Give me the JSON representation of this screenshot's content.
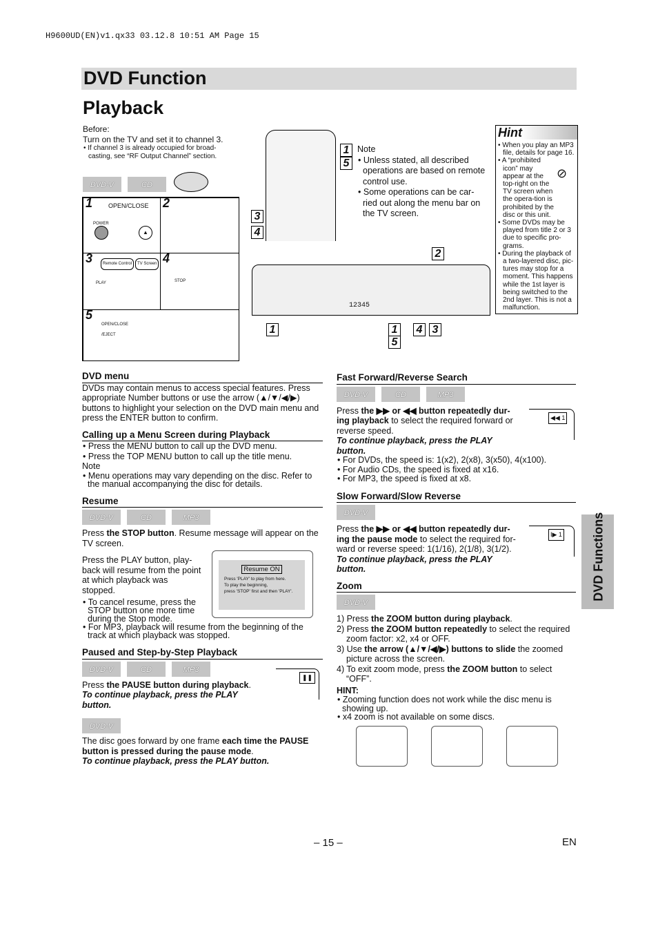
{
  "header": "H9600UD(EN)v1.qx33   03.12.8   10:51 AM   Page 15",
  "title": "DVD Function",
  "subtitle": "Playback",
  "side_tab": "DVD Functions",
  "before": {
    "label": "Before:",
    "text": "Turn on the TV and set it to channel 3.",
    "bullet": "If channel 3 is already occupied for broad-casting, see “RF Output Channel” section."
  },
  "badges": {
    "dvd": "DVD-V",
    "cd": "CD",
    "mp3": "MP3"
  },
  "steps": {
    "s1": "1",
    "s2": "2",
    "s3": "3",
    "s4": "4",
    "s5": "5",
    "open_close": "OPEN/CLOSE",
    "power": "POWER",
    "open_close_eject": "OPEN/CLOSE /EJECT",
    "remote_control": "Remote Control",
    "tv_screen": "TV Screen",
    "play": "PLAY",
    "stop": "STOP"
  },
  "note": {
    "label": "Note",
    "items": [
      "Unless stated, all described operations are based on remote control use.",
      "Some operations can be car-ried out along the menu bar on the TV screen."
    ]
  },
  "display_readout": "12345",
  "hint": {
    "title": "Hint",
    "items": [
      "When you play an MP3 file, details for page 16.",
      "A “prohibited icon” may appear at the top-right on the TV screen when the opera-tion is prohibited by the disc or this unit.",
      "Some DVDs may be played from title 2 or 3 due to specific pro-grams.",
      "During the playback of a two-layered disc, pic-tures may stop for a moment. This happens while the 1st layer is being switched to the 2nd layer. This is not a malfunction."
    ]
  },
  "dvd_menu": {
    "title": "DVD menu",
    "text": "DVDs may contain menus to access special features. Press appropriate Number buttons or use the arrow (▲/▼/◀/▶) buttons to highlight your selection on the DVD main menu and press the ENTER button to confirm."
  },
  "calling": {
    "title": "Calling up a Menu Screen during Playback",
    "items": [
      "Press the MENU button to call up the DVD menu.",
      "Press the TOP MENU button to call up the title menu."
    ],
    "note_label": "Note",
    "note": "Menu operations may vary depending on the disc. Refer to the manual accompanying the disc for details."
  },
  "resume": {
    "title": "Resume",
    "p1_a": "Press ",
    "p1_b": "the STOP button",
    "p1_c": ". Resume message will appear on the TV screen.",
    "p2": "Press the PLAY button, play-back will resume from the point at which playback was stopped.",
    "items": [
      "To cancel resume, press the STOP button one more time during the Stop mode.",
      "For MP3, playback will resume from the beginning  of the track at which playback was stopped."
    ],
    "screen_title": "Resume ON",
    "screen_lines": [
      "Press 'PLAY' to play from here.",
      "To play the beginning,",
      "press 'STOP' first and then 'PLAY'."
    ]
  },
  "paused": {
    "title": "Paused and Step-by-Step Playback",
    "p1_a": "Press ",
    "p1_b": "the PAUSE button during playback",
    "p1_c": ".",
    "cont": "To continue playback, press the PLAY button.",
    "p2_a": "The disc goes forward by one frame ",
    "p2_b": "each time the PAUSE button is pressed during the pause mode",
    "p2_c": ".",
    "cont2": "To continue playback, press the PLAY button."
  },
  "ff": {
    "title": "Fast Forward/Reverse Search",
    "p_a": "Press ",
    "p_b": "the ▶▶ or ◀◀ button repeatedly dur-ing playback",
    "p_c": " to select the required forward or reverse speed.",
    "cont": "To continue playback, press the PLAY button.",
    "items": [
      "For DVDs, the speed is: 1(x2), 2(x8), 3(x50), 4(x100).",
      "For Audio CDs, the speed is fixed at x16.",
      "For MP3, the speed is fixed at x8."
    ],
    "osd": "◀◀ 1"
  },
  "slow": {
    "title": "Slow Forward/Slow Reverse",
    "p_a": "Press ",
    "p_b": "the ▶▶ or ◀◀ button repeatedly dur-ing the pause mode",
    "p_c": " to select the required for-ward or reverse speed: 1(1/16), 2(1/8), 3(1/2).",
    "cont": "To continue playback, press the PLAY button.",
    "osd": "I▶ 1"
  },
  "zoom": {
    "title": "Zoom",
    "s1_a": "1) Press ",
    "s1_b": "the ZOOM button during playback",
    "s1_c": ".",
    "s2_a": "2) Press ",
    "s2_b": "the ZOOM button repeatedly",
    "s2_c": " to select the required zoom factor: x2, x4 or OFF.",
    "s3_a": "3) Use ",
    "s3_b": "the arrow (▲/▼/◀/▶) buttons to slide",
    "s3_c": " the zoomed picture across the screen.",
    "s4_a": "4) To exit zoom mode, press ",
    "s4_b": "the ZOOM button",
    "s4_c": " to select “OFF”.",
    "hint_label": "HINT:",
    "hints": [
      "Zooming function does not work while the disc menu is showing up.",
      "x4 zoom is not available on some discs."
    ]
  },
  "page_number": "– 15 –",
  "lang": "EN"
}
